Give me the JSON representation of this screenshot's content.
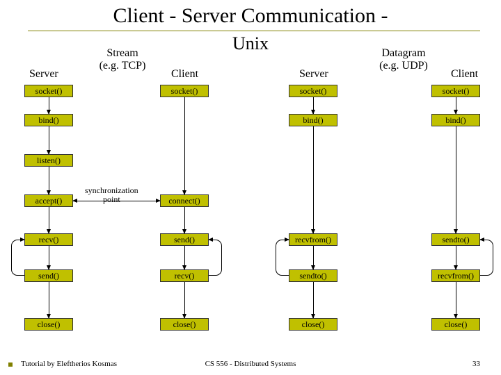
{
  "title": "Client - Server Communication -",
  "subtitle": "Unix",
  "stream_label": "Stream\n(e.g. TCP)",
  "datagram_label": "Datagram\n(e.g. UDP)",
  "headers": {
    "server": "Server",
    "client": "Client"
  },
  "sync_label": "synchronization\npoint",
  "footer": {
    "left": "Tutorial by Eleftherios Kosmas",
    "center": "CS 556 - Distributed Systems",
    "right": "33"
  },
  "tcp": {
    "server": [
      "socket()",
      "bind()",
      "listen()",
      "accept()",
      "recv()",
      "send()",
      "close()"
    ],
    "client": [
      "socket()",
      "connect()",
      "send()",
      "recv()",
      "close()"
    ]
  },
  "udp": {
    "server": [
      "socket()",
      "bind()",
      "recvfrom()",
      "sendto()",
      "close()"
    ],
    "client": [
      "socket()",
      "bind()",
      "sendto()",
      "recvfrom()",
      "close()"
    ]
  }
}
